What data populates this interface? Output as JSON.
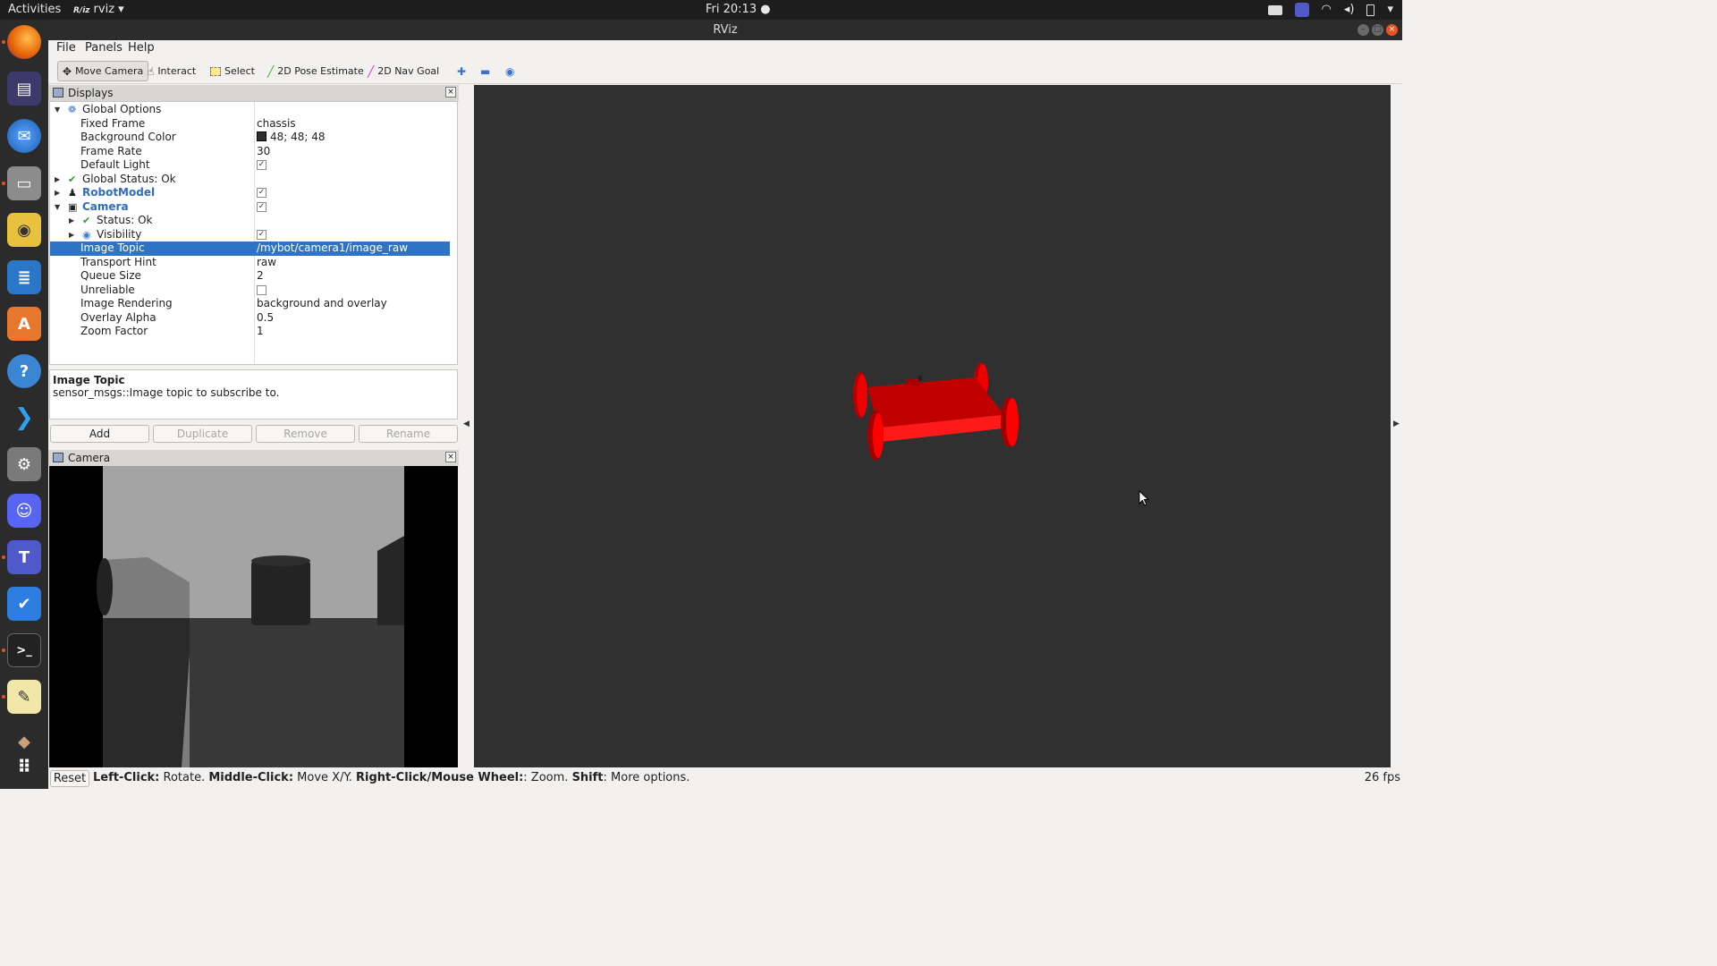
{
  "topbar": {
    "activities": "Activities",
    "app_name": "rviz",
    "app_prefix": "R/iz",
    "clock": "Fri 20:13 ●"
  },
  "window": {
    "title": "RViz"
  },
  "menu": [
    "File",
    "Panels",
    "Help"
  ],
  "toolbar": {
    "move_camera": "Move Camera",
    "interact": "Interact",
    "select": "Select",
    "pose_estimate": "2D Pose Estimate",
    "nav_goal": "2D Nav Goal"
  },
  "displays_panel": {
    "title": "Displays",
    "rows": [
      {
        "name": "Global Options",
        "value": ""
      },
      {
        "name": "Fixed Frame",
        "value": "chassis"
      },
      {
        "name": "Background Color",
        "value": "48; 48; 48"
      },
      {
        "name": "Frame Rate",
        "value": "30"
      },
      {
        "name": "Default Light",
        "value": "✓"
      },
      {
        "name": "Global Status: Ok",
        "value": ""
      },
      {
        "name": "RobotModel",
        "value": "✓"
      },
      {
        "name": "Camera",
        "value": "✓"
      },
      {
        "name": "Status: Ok",
        "value": ""
      },
      {
        "name": "Visibility",
        "value": "✓"
      },
      {
        "name": "Image Topic",
        "value": "/mybot/camera1/image_raw"
      },
      {
        "name": "Transport Hint",
        "value": "raw"
      },
      {
        "name": "Queue Size",
        "value": "2"
      },
      {
        "name": "Unreliable",
        "value": ""
      },
      {
        "name": "Image Rendering",
        "value": "background and overlay"
      },
      {
        "name": "Overlay Alpha",
        "value": "0.5"
      },
      {
        "name": "Zoom Factor",
        "value": "1"
      }
    ],
    "description_title": "Image Topic",
    "description_text": "sensor_msgs::Image topic to subscribe to.",
    "buttons": {
      "add": "Add",
      "duplicate": "Duplicate",
      "remove": "Remove",
      "rename": "Rename"
    }
  },
  "camera_panel": {
    "title": "Camera"
  },
  "statusbar": {
    "reset": "Reset",
    "hint_left_bold": "Left-Click:",
    "hint_left": " Rotate. ",
    "hint_middle_bold": "Middle-Click:",
    "hint_middle": " Move X/Y. ",
    "hint_right_bold": "Right-Click/Mouse Wheel:",
    "hint_right": ": Zoom. ",
    "hint_shift_bold": "Shift",
    "hint_shift": ": More options.",
    "fps": "26 fps"
  },
  "colors": {
    "background_3d": "#303030",
    "robot": "#e00000",
    "selection": "#2f74c4"
  },
  "icons": [
    "firefox-icon",
    "video-icon",
    "thunderbird-icon",
    "files-icon",
    "rhythmbox-icon",
    "writer-icon",
    "software-icon",
    "help-icon",
    "vscode-icon",
    "settings-icon",
    "discord-icon",
    "teams-icon",
    "tasks-icon",
    "terminal-icon",
    "editor-icon",
    "layers-icon",
    "apps-grid-icon"
  ]
}
